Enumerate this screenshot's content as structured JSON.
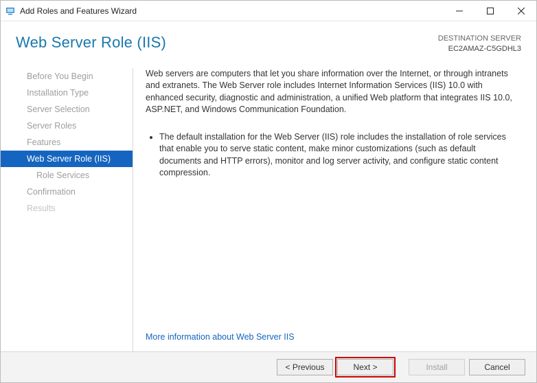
{
  "window": {
    "title": "Add Roles and Features Wizard"
  },
  "header": {
    "heading": "Web Server Role (IIS)",
    "destination_label": "DESTINATION SERVER",
    "destination_value": "EC2AMAZ-C5GDHL3"
  },
  "sidebar": {
    "items": [
      {
        "label": "Before You Begin",
        "active": false,
        "nested": false
      },
      {
        "label": "Installation Type",
        "active": false,
        "nested": false
      },
      {
        "label": "Server Selection",
        "active": false,
        "nested": false
      },
      {
        "label": "Server Roles",
        "active": false,
        "nested": false
      },
      {
        "label": "Features",
        "active": false,
        "nested": false
      },
      {
        "label": "Web Server Role (IIS)",
        "active": true,
        "nested": false
      },
      {
        "label": "Role Services",
        "active": false,
        "nested": true
      },
      {
        "label": "Confirmation",
        "active": false,
        "nested": false
      },
      {
        "label": "Results",
        "active": false,
        "nested": false,
        "disabled": true
      }
    ]
  },
  "content": {
    "intro": "Web servers are computers that let you share information over the Internet, or through intranets and extranets. The Web Server role includes Internet Information Services (IIS) 10.0 with enhanced security, diagnostic and administration, a unified Web platform that integrates IIS 10.0, ASP.NET, and Windows Communication Foundation.",
    "bullets": [
      "The default installation for the Web Server (IIS) role includes the installation of role services that enable you to serve static content, make minor customizations (such as default documents and HTTP errors), monitor and log server activity, and configure static content compression."
    ],
    "more_info": "More information about Web Server IIS"
  },
  "footer": {
    "previous": "< Previous",
    "next": "Next >",
    "install": "Install",
    "cancel": "Cancel"
  }
}
